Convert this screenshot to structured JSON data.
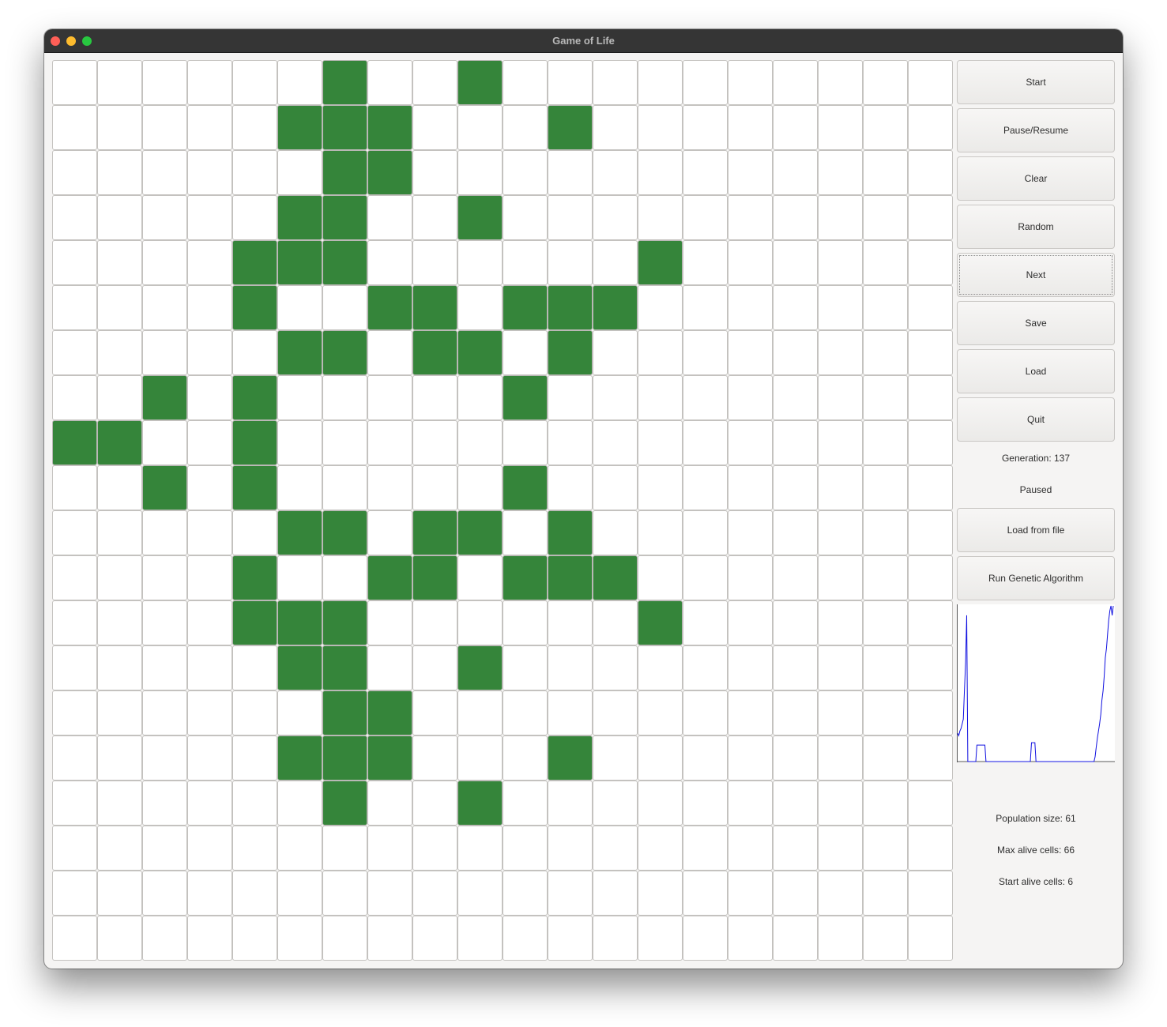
{
  "window": {
    "title": "Game of Life"
  },
  "board": {
    "rows": 20,
    "cols": 20,
    "alive_color": "#35853a",
    "dead_color": "#ffffff",
    "alive_cells": [
      [
        0,
        6
      ],
      [
        0,
        9
      ],
      [
        1,
        5
      ],
      [
        1,
        6
      ],
      [
        1,
        7
      ],
      [
        1,
        11
      ],
      [
        2,
        6
      ],
      [
        2,
        7
      ],
      [
        3,
        5
      ],
      [
        3,
        6
      ],
      [
        3,
        9
      ],
      [
        4,
        4
      ],
      [
        4,
        5
      ],
      [
        4,
        6
      ],
      [
        4,
        13
      ],
      [
        5,
        4
      ],
      [
        5,
        7
      ],
      [
        5,
        8
      ],
      [
        5,
        10
      ],
      [
        5,
        11
      ],
      [
        5,
        12
      ],
      [
        6,
        5
      ],
      [
        6,
        6
      ],
      [
        6,
        8
      ],
      [
        6,
        9
      ],
      [
        6,
        11
      ],
      [
        7,
        2
      ],
      [
        7,
        4
      ],
      [
        7,
        10
      ],
      [
        8,
        0
      ],
      [
        8,
        1
      ],
      [
        8,
        4
      ],
      [
        9,
        2
      ],
      [
        9,
        4
      ],
      [
        9,
        10
      ],
      [
        10,
        5
      ],
      [
        10,
        6
      ],
      [
        10,
        8
      ],
      [
        10,
        9
      ],
      [
        10,
        11
      ],
      [
        11,
        4
      ],
      [
        11,
        7
      ],
      [
        11,
        8
      ],
      [
        11,
        10
      ],
      [
        11,
        11
      ],
      [
        11,
        12
      ],
      [
        12,
        4
      ],
      [
        12,
        5
      ],
      [
        12,
        6
      ],
      [
        12,
        13
      ],
      [
        13,
        5
      ],
      [
        13,
        6
      ],
      [
        13,
        9
      ],
      [
        14,
        6
      ],
      [
        14,
        7
      ],
      [
        15,
        5
      ],
      [
        15,
        6
      ],
      [
        15,
        7
      ],
      [
        15,
        11
      ],
      [
        16,
        6
      ],
      [
        16,
        9
      ]
    ]
  },
  "controls": {
    "start": "Start",
    "pause_resume": "Pause/Resume",
    "clear": "Clear",
    "random": "Random",
    "next": "Next",
    "save": "Save",
    "load": "Load",
    "quit": "Quit",
    "load_from_file": "Load from file",
    "run_genetic": "Run Genetic Algorithm"
  },
  "status": {
    "generation": "Generation: 137",
    "state": "Paused"
  },
  "genetic": {
    "population_size": "Population size: 61",
    "max_alive_cells": "Max alive cells: 66",
    "start_alive_cells": "Start alive cells: 6"
  },
  "chart_data": {
    "type": "line",
    "title": "",
    "xlabel": "",
    "ylabel": "",
    "line_color": "#1010e0",
    "x": [
      0,
      1,
      2,
      3,
      4,
      5,
      6,
      7,
      8,
      9,
      10,
      11,
      12,
      13,
      14,
      15,
      16,
      17,
      18,
      19,
      20,
      21,
      22,
      23,
      24,
      25,
      26,
      27,
      28,
      29,
      30,
      31,
      32,
      33,
      34,
      35,
      36,
      37,
      38,
      39,
      40,
      41,
      42,
      43,
      44,
      45,
      46,
      47,
      48,
      49,
      50,
      51,
      52,
      53,
      54,
      55,
      56,
      57,
      58,
      59,
      60,
      61,
      62,
      63,
      64,
      65,
      66,
      67,
      68,
      69,
      70,
      71,
      72,
      73,
      74,
      75,
      76,
      77,
      78,
      79,
      80,
      81,
      82,
      83,
      84,
      85,
      86,
      87,
      88,
      89,
      90,
      91,
      92,
      93,
      94,
      95,
      96,
      97,
      98,
      99,
      100,
      101,
      102,
      103,
      104,
      105,
      106,
      107,
      108,
      109,
      110,
      111,
      112,
      113,
      114,
      115,
      116,
      117,
      118,
      119,
      120,
      121,
      122,
      123,
      124,
      125,
      126,
      127,
      128,
      129,
      130,
      131,
      132,
      133,
      134,
      135,
      136,
      137
    ],
    "values": [
      12,
      11,
      13,
      14,
      16,
      18,
      30,
      42,
      62,
      0,
      0,
      0,
      0,
      0,
      0,
      0,
      0,
      7,
      7,
      7,
      7,
      7,
      7,
      7,
      7,
      0,
      0,
      0,
      0,
      0,
      0,
      0,
      0,
      0,
      0,
      0,
      0,
      0,
      0,
      0,
      0,
      0,
      0,
      0,
      0,
      0,
      0,
      0,
      0,
      0,
      0,
      0,
      0,
      0,
      0,
      0,
      0,
      0,
      0,
      0,
      0,
      0,
      0,
      0,
      0,
      8,
      8,
      8,
      8,
      0,
      0,
      0,
      0,
      0,
      0,
      0,
      0,
      0,
      0,
      0,
      0,
      0,
      0,
      0,
      0,
      0,
      0,
      0,
      0,
      0,
      0,
      0,
      0,
      0,
      0,
      0,
      0,
      0,
      0,
      0,
      0,
      0,
      0,
      0,
      0,
      0,
      0,
      0,
      0,
      0,
      0,
      0,
      0,
      0,
      0,
      0,
      0,
      0,
      0,
      0,
      0,
      2,
      6,
      10,
      13,
      16,
      20,
      26,
      30,
      36,
      44,
      48,
      54,
      60,
      64,
      66,
      62,
      66
    ],
    "ylim": [
      0,
      66
    ],
    "xlim": [
      0,
      137
    ]
  }
}
